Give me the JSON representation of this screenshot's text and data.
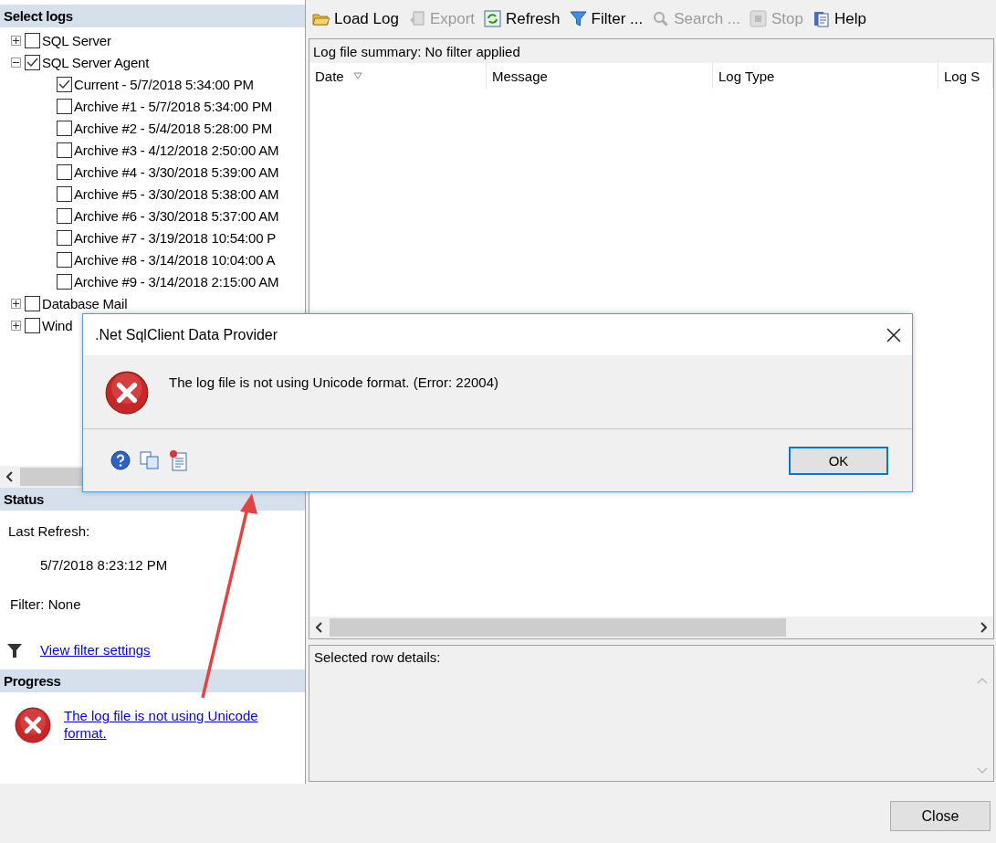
{
  "select_logs": {
    "title": "Select logs",
    "tree": [
      {
        "label": "SQL Server",
        "checked": false,
        "expanded": false
      },
      {
        "label": "SQL Server Agent",
        "checked": true,
        "expanded": true,
        "children": [
          {
            "label": "Current - 5/7/2018 5:34:00 PM",
            "checked": true
          },
          {
            "label": "Archive #1 - 5/7/2018 5:34:00 PM",
            "checked": false
          },
          {
            "label": "Archive #2 - 5/4/2018 5:28:00 PM",
            "checked": false
          },
          {
            "label": "Archive #3 - 4/12/2018 2:50:00 AM",
            "checked": false
          },
          {
            "label": "Archive #4 - 3/30/2018 5:39:00 AM",
            "checked": false
          },
          {
            "label": "Archive #5 - 3/30/2018 5:38:00 AM",
            "checked": false
          },
          {
            "label": "Archive #6 - 3/30/2018 5:37:00 AM",
            "checked": false
          },
          {
            "label": "Archive #7 - 3/19/2018 10:54:00 P",
            "checked": false
          },
          {
            "label": "Archive #8 - 3/14/2018 10:04:00 A",
            "checked": false
          },
          {
            "label": "Archive #9 - 3/14/2018 2:15:00 AM",
            "checked": false
          }
        ]
      },
      {
        "label": "Database Mail",
        "checked": false,
        "expanded": false
      },
      {
        "label": "Wind",
        "checked": false,
        "expanded": false
      }
    ]
  },
  "status": {
    "title": "Status",
    "last_refresh_label": "Last Refresh:",
    "last_refresh": "5/7/2018 8:23:12 PM",
    "filter": "Filter: None",
    "link": "View filter settings"
  },
  "progress": {
    "title": "Progress",
    "link": "The log file is not using Unicode format."
  },
  "toolbar": [
    {
      "kind": "load",
      "label": "Load Log",
      "disabled": false
    },
    {
      "kind": "export",
      "label": "Export",
      "disabled": true
    },
    {
      "kind": "refresh",
      "label": "Refresh",
      "disabled": false
    },
    {
      "kind": "filter",
      "label": "Filter ...",
      "disabled": false
    },
    {
      "kind": "search",
      "label": "Search ...",
      "disabled": true
    },
    {
      "kind": "stop",
      "label": "Stop",
      "disabled": true
    },
    {
      "kind": "help",
      "label": "Help",
      "disabled": false
    }
  ],
  "log_view": {
    "summary": "Log file summary: No filter applied",
    "columns": [
      "Date",
      "Message",
      "Log Type",
      "Log S"
    ]
  },
  "details": {
    "label": "Selected row details:"
  },
  "close_button": "Close",
  "dialog": {
    "title": ".Net SqlClient Data Provider",
    "message": "The log file is not using Unicode format. (Error: 22004)",
    "button": "OK"
  }
}
